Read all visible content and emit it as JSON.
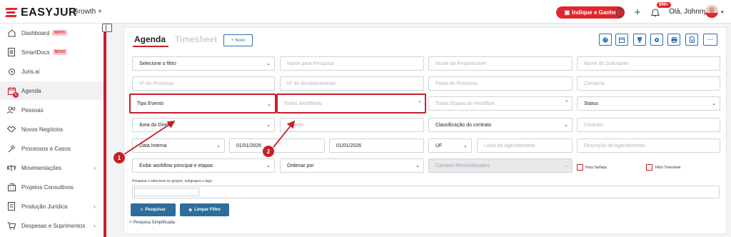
{
  "app": {
    "brand": "EASYJUR",
    "plan": "Growth +",
    "accent": "#e1262c"
  },
  "header": {
    "indique_label": "Indique e Ganhe",
    "notif_count": "999+",
    "greeting": "Olá, Johnny",
    "icons": [
      "clock-icon",
      "plus-icon",
      "bell-icon"
    ]
  },
  "sidebar": {
    "items": [
      {
        "label": "Dashboard",
        "badge": "NOVO",
        "icon": "home-icon"
      },
      {
        "label": "SmartDocs",
        "badge": "NOVO",
        "icon": "document-icon"
      },
      {
        "label": "Juris.ai",
        "icon": "ai-icon"
      },
      {
        "label": "Agenda",
        "icon": "calendar-icon",
        "count": "6"
      },
      {
        "label": "Pessoas",
        "icon": "people-icon"
      },
      {
        "label": "Novos Negócios",
        "icon": "handshake-icon"
      },
      {
        "label": "Processos e Casos",
        "icon": "gavel-icon"
      },
      {
        "label": "Movimentações",
        "icon": "scale-icon",
        "has_children": true
      },
      {
        "label": "Projetos Consultivos",
        "icon": "building-icon"
      },
      {
        "label": "Produção Jurídica",
        "icon": "file-icon",
        "has_children": true
      },
      {
        "label": "Despesas e Suprimentos",
        "icon": "cart-icon",
        "has_children": true
      }
    ]
  },
  "main": {
    "tabs": [
      {
        "label": "Agenda",
        "active": true
      },
      {
        "label": "Timesheet",
        "active": false
      }
    ],
    "new_button": "+ Novo",
    "toolbar_icons": [
      "help-icon",
      "calendar-icon",
      "trophy-icon",
      "settings-icon",
      "print-icon",
      "export-icon",
      "more-icon"
    ],
    "filters": {
      "select_filter": "Selecione o filtro",
      "search_name": "Nome para Pesquisa",
      "responsible": "Nome do Responsável",
      "requester": "Nome do Solicitante",
      "process_no": "Nº do Processo",
      "split_no": "Nº do desdobramento",
      "process_folder": "Pasta do Processo",
      "district": "Comarca",
      "event_type": "Tipo Evento",
      "workflows": "Todos Workflows",
      "workflow_stages": "Todas Etapas do Workflow",
      "status": "Status",
      "law_area": "Área do Direito",
      "project": "Projeto",
      "contract_class": "Classificação do contrato",
      "contract": "Contrato",
      "date_type": "Data Interna",
      "date_from": "01/01/2026",
      "date_to": "01/01/2026",
      "uf": "UF",
      "location": "Local do Agendamento",
      "description": "Descrição do Agendamento",
      "workflow_display": "Exibir workflow principal e etapas",
      "order_by": "Ordenar por",
      "custom_fields": "Campos Personalizados",
      "billed_hours": "Hora Tarifada",
      "timesheet_filter": "Filtro Timesheet"
    },
    "tags_hint": "Pesquise e selecione os grupos, subgrupos e tags:",
    "search_button": "Pesquisar",
    "clear_button": "Limpar Filtro",
    "simple_search": "Pesquisa Simplificada"
  },
  "annotations": [
    "1",
    "2"
  ]
}
